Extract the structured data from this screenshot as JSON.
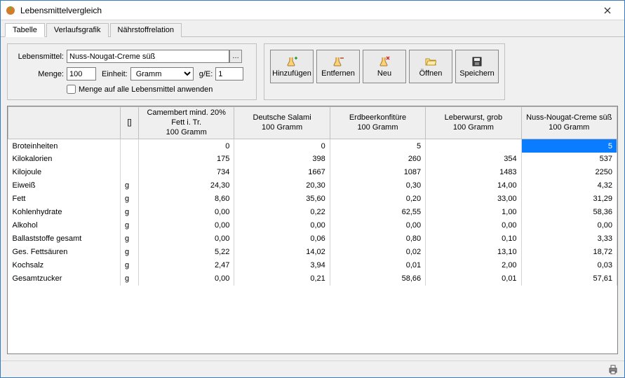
{
  "window": {
    "title": "Lebensmittelvergleich"
  },
  "tabs": [
    {
      "label": "Tabelle",
      "active": true
    },
    {
      "label": "Verlaufsgrafik",
      "active": false
    },
    {
      "label": "Nährstoffrelation",
      "active": false
    }
  ],
  "form": {
    "food_label": "Lebensmittel:",
    "food_value": "Nuss-Nougat-Creme süß",
    "amount_label": "Menge:",
    "amount_value": "100",
    "unit_label": "Einheit:",
    "unit_value": "Gramm",
    "ge_label": "g/E:",
    "ge_value": "1",
    "apply_all_label": "Menge auf alle Lebensmittel anwenden"
  },
  "toolbar": {
    "add": "Hinzufügen",
    "remove": "Entfernen",
    "new": "Neu",
    "open": "Öffnen",
    "save": "Speichern"
  },
  "table": {
    "unit_header": "[]",
    "columns": [
      {
        "line1": "Camembert mind. 20% Fett i. Tr.",
        "line2": "100 Gramm"
      },
      {
        "line1": "Deutsche Salami",
        "line2": "100 Gramm"
      },
      {
        "line1": "Erdbeerkonfitüre",
        "line2": "100 Gramm"
      },
      {
        "line1": "Leberwurst, grob",
        "line2": "100 Gramm"
      },
      {
        "line1": "Nuss-Nougat-Creme süß",
        "line2": "100 Gramm"
      }
    ],
    "rows": [
      {
        "name": "Broteinheiten",
        "unit": "",
        "values": [
          "0",
          "0",
          "5",
          "",
          "5"
        ],
        "selected_col": 4
      },
      {
        "name": "Kilokalorien",
        "unit": "",
        "values": [
          "175",
          "398",
          "260",
          "354",
          "537"
        ]
      },
      {
        "name": "Kilojoule",
        "unit": "",
        "values": [
          "734",
          "1667",
          "1087",
          "1483",
          "2250"
        ]
      },
      {
        "name": "Eiweiß",
        "unit": "g",
        "values": [
          "24,30",
          "20,30",
          "0,30",
          "14,00",
          "4,32"
        ]
      },
      {
        "name": "Fett",
        "unit": "g",
        "values": [
          "8,60",
          "35,60",
          "0,20",
          "33,00",
          "31,29"
        ]
      },
      {
        "name": "Kohlenhydrate",
        "unit": "g",
        "values": [
          "0,00",
          "0,22",
          "62,55",
          "1,00",
          "58,36"
        ]
      },
      {
        "name": "Alkohol",
        "unit": "g",
        "values": [
          "0,00",
          "0,00",
          "0,00",
          "0,00",
          "0,00"
        ]
      },
      {
        "name": "Ballaststoffe gesamt",
        "unit": "g",
        "values": [
          "0,00",
          "0,06",
          "0,80",
          "0,10",
          "3,33"
        ]
      },
      {
        "name": "Ges. Fettsäuren",
        "unit": "g",
        "values": [
          "5,22",
          "14,02",
          "0,02",
          "13,10",
          "18,72"
        ]
      },
      {
        "name": "Kochsalz",
        "unit": "g",
        "values": [
          "2,47",
          "3,94",
          "0,01",
          "2,00",
          "0,03"
        ]
      },
      {
        "name": "Gesamtzucker",
        "unit": "g",
        "values": [
          "0,00",
          "0,21",
          "58,66",
          "0,01",
          "57,61"
        ]
      }
    ]
  }
}
